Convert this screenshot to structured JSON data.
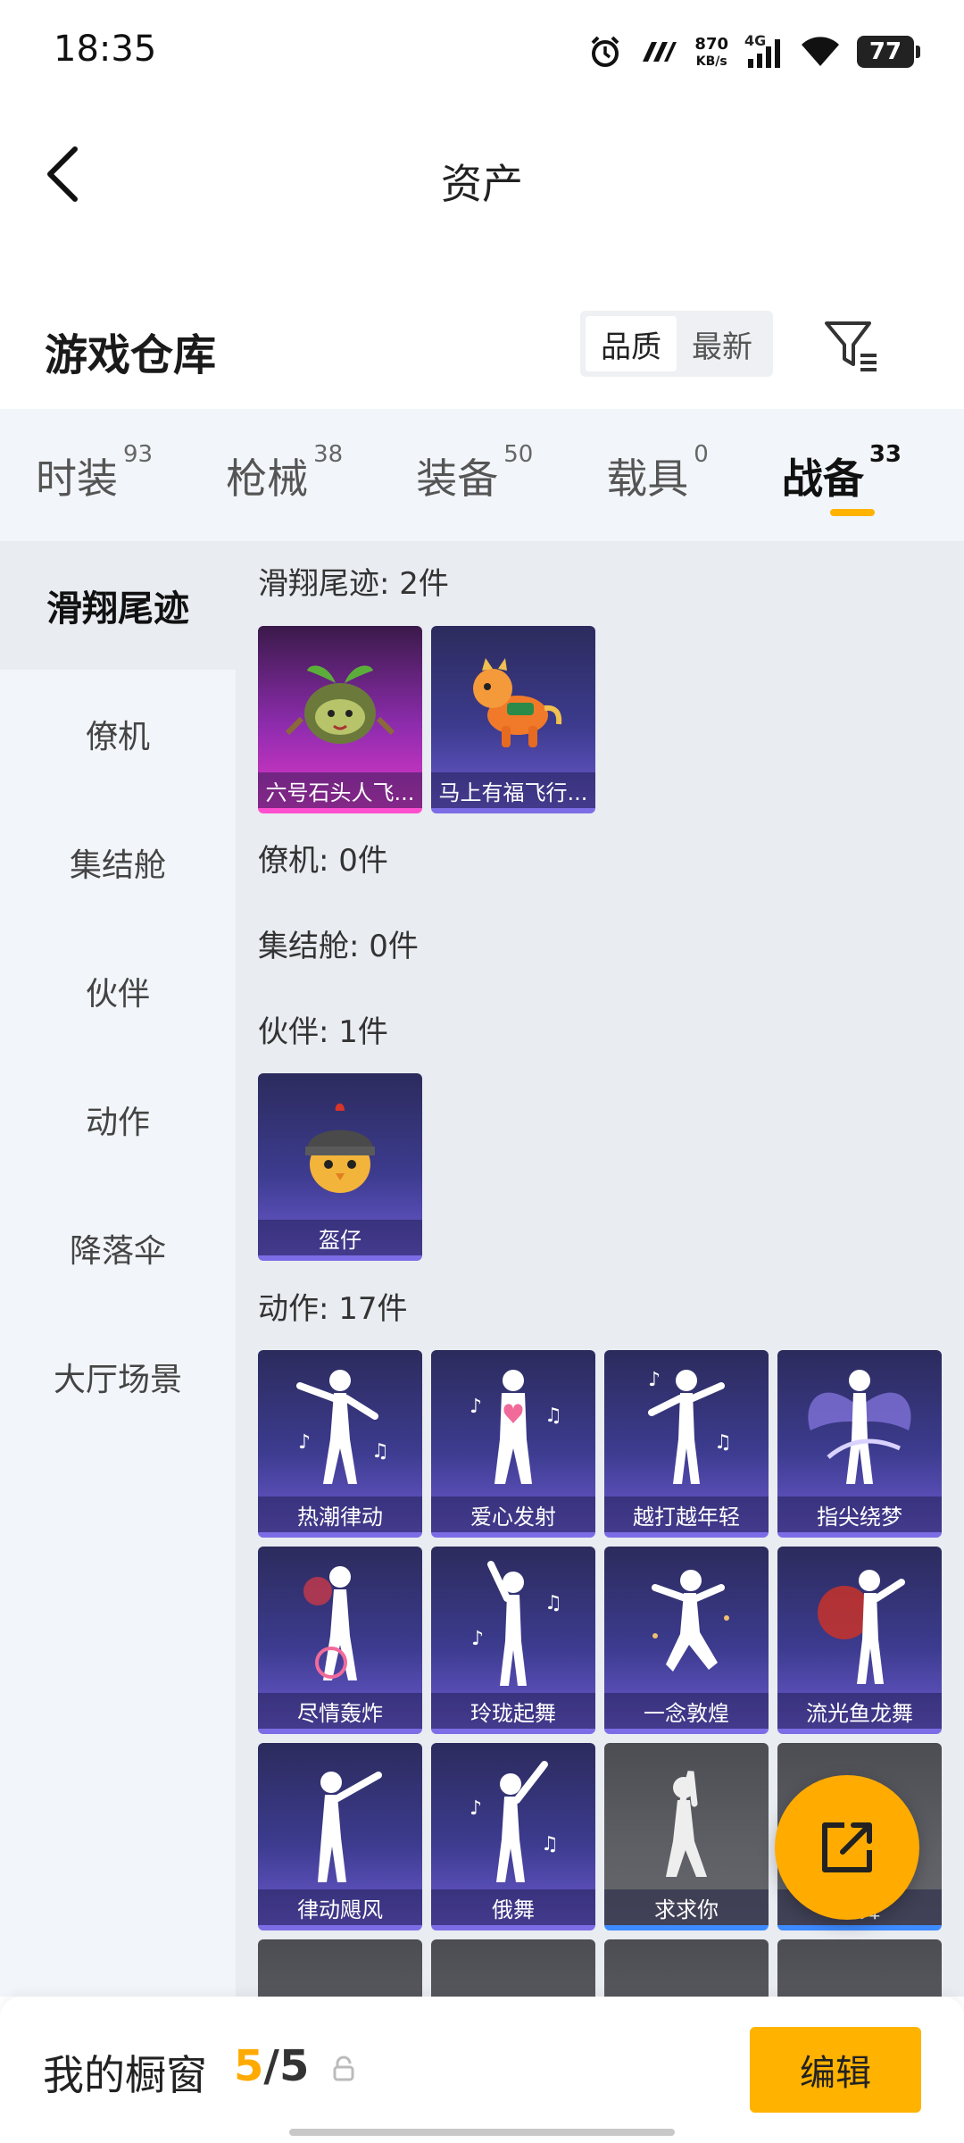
{
  "status_bar": {
    "time": "18:35",
    "net_speed_value": "870",
    "net_speed_unit": "KB/s",
    "network": "4G",
    "battery": "77",
    "icons": [
      "alarm-icon",
      "carrier-icon",
      "signal-icon",
      "wifi-icon",
      "battery-icon"
    ]
  },
  "nav": {
    "title": "资产",
    "back_icon": "back-arrow-icon"
  },
  "warehouse": {
    "title": "游戏仓库",
    "sort_options": [
      "品质",
      "最新"
    ],
    "active_sort": "品质",
    "filter_icon": "filter-icon"
  },
  "tabs": [
    {
      "label": "时装",
      "count": "93",
      "active": false
    },
    {
      "label": "枪械",
      "count": "38",
      "active": false
    },
    {
      "label": "装备",
      "count": "50",
      "active": false
    },
    {
      "label": "载具",
      "count": "0",
      "active": false
    },
    {
      "label": "战备",
      "count": "33",
      "active": true
    }
  ],
  "sidebar": {
    "items": [
      "滑翔尾迹",
      "僚机",
      "集结舱",
      "伙伴",
      "动作",
      "降落伞",
      "大厅场景"
    ],
    "active": "滑翔尾迹"
  },
  "groups": {
    "trail": {
      "title": "滑翔尾迹: 2件",
      "items": [
        {
          "name": "六号石头人飞...",
          "rarity": "pink",
          "icon": "sprout-creature-icon"
        },
        {
          "name": "马上有福飞行...",
          "rarity": "purple",
          "icon": "toy-horse-icon"
        }
      ]
    },
    "wingman": {
      "title": "僚机: 0件"
    },
    "capsule": {
      "title": "集结舱: 0件"
    },
    "partner": {
      "title": "伙伴: 1件",
      "items": [
        {
          "name": "盔仔",
          "rarity": "purple",
          "icon": "helmet-chick-icon"
        }
      ]
    },
    "emote": {
      "title": "动作: 17件",
      "items": [
        {
          "name": "热潮律动",
          "rarity": "purple",
          "icon": "dance-pose-icon"
        },
        {
          "name": "爱心发射",
          "rarity": "purple",
          "icon": "heart-pose-icon"
        },
        {
          "name": "越打越年轻",
          "rarity": "purple",
          "icon": "dance-pose-icon"
        },
        {
          "name": "指尖绕梦",
          "rarity": "purple",
          "icon": "wing-pose-icon"
        },
        {
          "name": "尽情轰炸",
          "rarity": "purple",
          "icon": "dance-pose-icon"
        },
        {
          "name": "玲珑起舞",
          "rarity": "purple",
          "icon": "dance-pose-icon"
        },
        {
          "name": "一念敦煌",
          "rarity": "purple",
          "icon": "dance-pose-icon"
        },
        {
          "name": "流光鱼龙舞",
          "rarity": "purple",
          "icon": "dance-pose-icon"
        },
        {
          "name": "律动飓风",
          "rarity": "purple",
          "icon": "dance-pose-icon"
        },
        {
          "name": "俄舞",
          "rarity": "purple",
          "icon": "dance-pose-icon"
        },
        {
          "name": "求求你",
          "rarity": "gray",
          "icon": "pray-pose-icon"
        },
        {
          "name": "...舞",
          "rarity": "gray",
          "icon": "dance-pose-icon"
        }
      ]
    }
  },
  "fab": {
    "icon": "share-out-icon"
  },
  "bottom_bar": {
    "label": "我的橱窗",
    "current": "5",
    "sep": "/",
    "max": "5",
    "lock_icon": "lock-icon",
    "edit_label": "编辑"
  },
  "colors": {
    "accent": "#ffb300",
    "purple_card": "#3c3b8e",
    "pink_card": "#e038c7",
    "gray_card": "#5f6066"
  }
}
